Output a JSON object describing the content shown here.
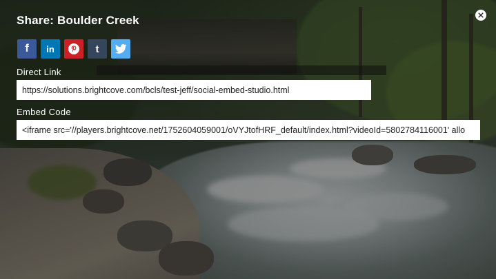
{
  "share": {
    "title": "Share: Boulder Creek",
    "close_icon": "close-icon",
    "social": [
      {
        "name": "facebook",
        "glyph": "f",
        "color": "#3b5998"
      },
      {
        "name": "linkedin",
        "glyph": "in",
        "color": "#0077b5"
      },
      {
        "name": "pinterest",
        "glyph": "P",
        "color": "#cb2027"
      },
      {
        "name": "tumblr",
        "glyph": "t",
        "color": "#35465c"
      },
      {
        "name": "twitter",
        "glyph": "bird",
        "color": "#55acee"
      }
    ],
    "direct_link": {
      "label": "Direct Link",
      "value": "https://solutions.brightcove.com/bcls/test-jeff/social-embed-studio.html"
    },
    "embed_code": {
      "label": "Embed Code",
      "value": "<iframe src='//players.brightcove.net/1752604059001/oVYJtofHRF_default/index.html?videoId=5802784116001' allo"
    }
  }
}
